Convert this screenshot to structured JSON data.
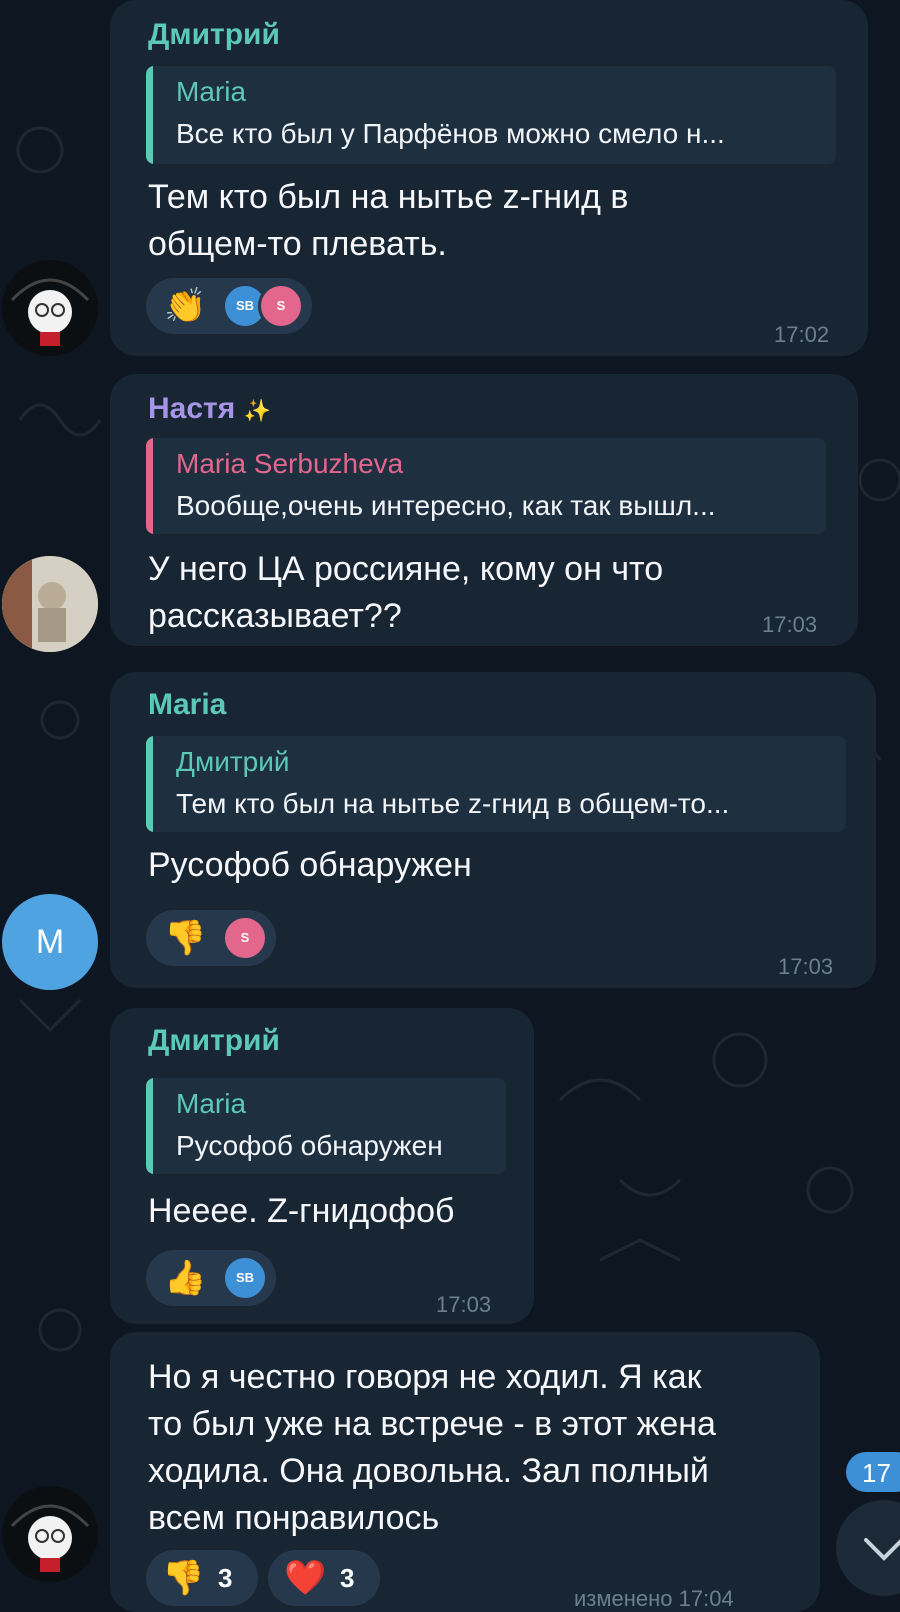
{
  "messages": [
    {
      "sender": "Дмитрий",
      "reply_to": {
        "name": "Maria",
        "text": "Все кто был у Парфёнов можно смело н..."
      },
      "text": [
        "Тем кто был на нытье z-гнид в",
        "общем-то плевать."
      ],
      "reactions": [
        {
          "emoji": "👏",
          "avatars": [
            "SB",
            "S"
          ]
        }
      ],
      "time": "17:02"
    },
    {
      "sender": "Настя",
      "sender_emoji": "✨",
      "reply_to": {
        "name": "Maria Serbuzheva",
        "text": "Вообще,очень интересно, как так вышл..."
      },
      "text": [
        "У него ЦА россияне, кому он что",
        "рассказывает??"
      ],
      "time": "17:03"
    },
    {
      "sender": "Maria",
      "avatar_letter": "M",
      "reply_to": {
        "name": "Дмитрий",
        "text": "Тем кто был на нытье z-гнид в общем-то..."
      },
      "text": [
        "Русофоб обнаружен"
      ],
      "reactions": [
        {
          "emoji": "👎",
          "avatars": [
            "S"
          ]
        }
      ],
      "time": "17:03"
    },
    {
      "sender": "Дмитрий",
      "reply_to": {
        "name": "Maria",
        "text": "Русофоб обнаружен"
      },
      "text": [
        "Нееее. Z-гнидофоб"
      ],
      "reactions": [
        {
          "emoji": "👍",
          "avatars": [
            "SB"
          ]
        }
      ],
      "time": "17:03"
    },
    {
      "text": [
        "Но я честно говоря не ходил. Я как",
        "то был уже на встрече - в этот жена",
        "ходила. Она довольна. Зал полный",
        "всем понравилось"
      ],
      "reactions": [
        {
          "emoji": "👎",
          "count": "3"
        },
        {
          "emoji": "❤️",
          "count": "3"
        }
      ],
      "time": "изменено 17:04"
    }
  ],
  "scroll": {
    "unread_badge": "17",
    "down_icon": "chevron-down-icon"
  },
  "colors": {
    "background": "#0e1621",
    "bubble": "#182533",
    "name_teal": "#5cc9b6",
    "name_violet": "#a695e7",
    "name_pink": "#e3668d",
    "badge_blue": "#3e90d6"
  }
}
